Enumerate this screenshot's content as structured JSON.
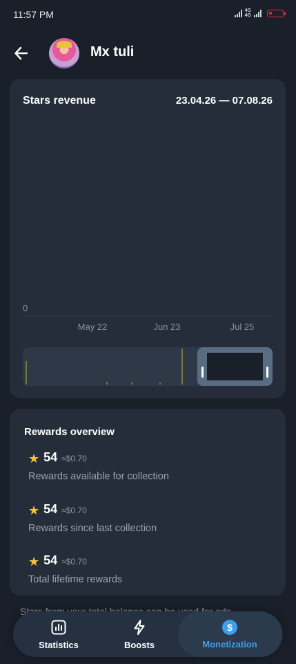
{
  "status_bar": {
    "time": "11:57 PM",
    "network_label_top": "4G",
    "network_label_bottom": "4G"
  },
  "header": {
    "chat_name": "Mx tuli"
  },
  "chart_card": {
    "title": "Stars revenue",
    "date_range": "23.04.26 — 07.08.26"
  },
  "chart_data": {
    "type": "bar",
    "title": "Stars revenue",
    "y_ticks": [
      "0"
    ],
    "x_ticks": [
      "May 22",
      "Jun 23",
      "Jul 25"
    ],
    "ylim": [
      0,
      1
    ],
    "grid": false,
    "legend": "none",
    "series_color": "#c8b33a"
  },
  "rewards": {
    "title": "Rewards overview",
    "items": [
      {
        "amount": "54",
        "usd": "≈$0.70",
        "caption": "Rewards available for collection"
      },
      {
        "amount": "54",
        "usd": "≈$0.70",
        "caption": "Rewards since last collection"
      },
      {
        "amount": "54",
        "usd": "≈$0.70",
        "caption": "Total lifetime rewards"
      }
    ]
  },
  "footer_note": "Stars from your total balance can be used for ads",
  "tabs": [
    {
      "label": "Statistics",
      "icon": "bar-chart-icon",
      "active": false
    },
    {
      "label": "Boosts",
      "icon": "lightning-icon",
      "active": false
    },
    {
      "label": "Monetization",
      "icon": "dollar-coin-icon",
      "active": true
    }
  ],
  "colors": {
    "background": "#1a2029",
    "card": "#242d39",
    "accent": "#3f9ee8",
    "star": "#f5c33b"
  }
}
